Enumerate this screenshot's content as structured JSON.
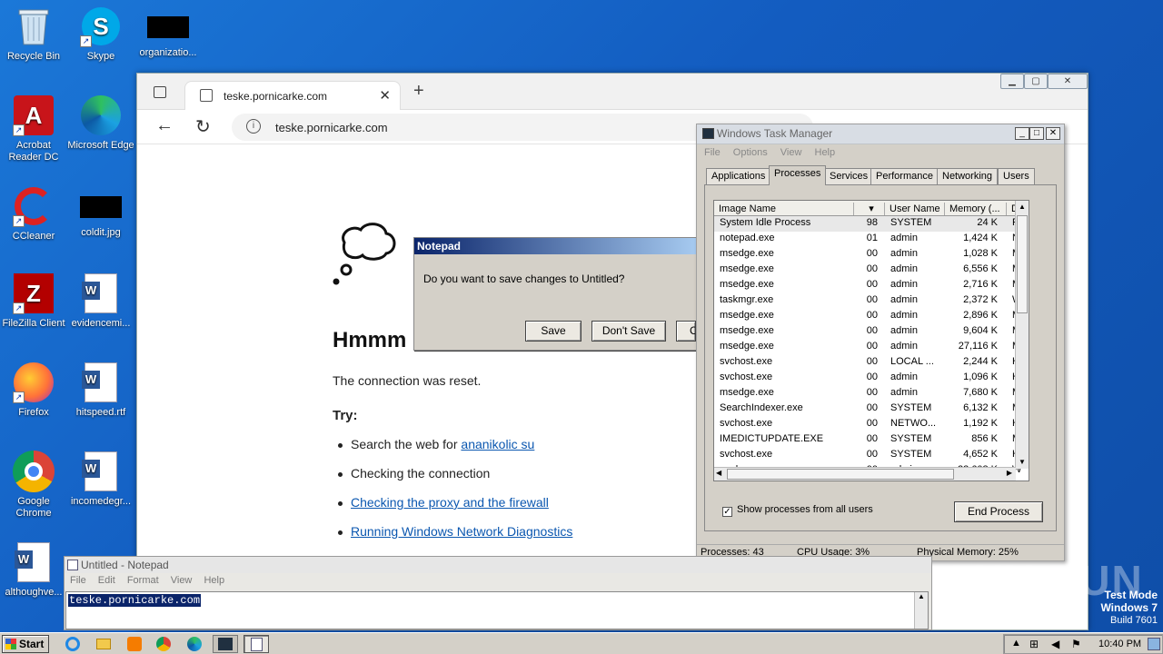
{
  "desktop": {
    "icons": [
      {
        "label": "Recycle Bin"
      },
      {
        "label": "Skype"
      },
      {
        "label": "organizatio..."
      },
      {
        "label": "Acrobat Reader DC"
      },
      {
        "label": "Microsoft Edge"
      },
      {
        "label": "CCleaner"
      },
      {
        "label": "coldit.jpg"
      },
      {
        "label": "FileZilla Client"
      },
      {
        "label": "evidencemi..."
      },
      {
        "label": "Firefox"
      },
      {
        "label": "hitspeed.rtf"
      },
      {
        "label": "Google Chrome"
      },
      {
        "label": "incomedegr..."
      },
      {
        "label": "althoughve..."
      }
    ]
  },
  "browser": {
    "tab_title": "teske.pornicarke.com",
    "url": "teske.pornicarke.com",
    "error": {
      "title": "Hmmm",
      "line": "The connection was reset.",
      "try_heading": "Try:",
      "suggestion_prefix": "Search the web for ",
      "suggestion_link": "ananikolic su",
      "item2": "Checking the connection",
      "item3": "Checking the proxy and the firewall",
      "item4": "Running Windows Network Diagnostics"
    }
  },
  "save_dialog": {
    "title": "Notepad",
    "message": "Do you want to save changes to Untitled?",
    "save": "Save",
    "dont_save": "Don't Save",
    "cancel": "C"
  },
  "task_manager": {
    "title": "Windows Task Manager",
    "menu": [
      "File",
      "Options",
      "View",
      "Help"
    ],
    "tabs": [
      "Applications",
      "Processes",
      "Services",
      "Performance",
      "Networking",
      "Users"
    ],
    "active_tab": "Processes",
    "columns": [
      "Image Name",
      "User Name",
      "Memory (...",
      "D"
    ],
    "rows": [
      {
        "name": "System Idle Process",
        "cpu": "98",
        "user": "SYSTEM",
        "mem": "24 K",
        "d": "Pe"
      },
      {
        "name": "notepad.exe",
        "cpu": "01",
        "user": "admin",
        "mem": "1,424 K",
        "d": "N"
      },
      {
        "name": "msedge.exe",
        "cpu": "00",
        "user": "admin",
        "mem": "1,028 K",
        "d": "M"
      },
      {
        "name": "msedge.exe",
        "cpu": "00",
        "user": "admin",
        "mem": "6,556 K",
        "d": "M"
      },
      {
        "name": "msedge.exe",
        "cpu": "00",
        "user": "admin",
        "mem": "2,716 K",
        "d": "M"
      },
      {
        "name": "taskmgr.exe",
        "cpu": "00",
        "user": "admin",
        "mem": "2,372 K",
        "d": "W"
      },
      {
        "name": "msedge.exe",
        "cpu": "00",
        "user": "admin",
        "mem": "2,896 K",
        "d": "M"
      },
      {
        "name": "msedge.exe",
        "cpu": "00",
        "user": "admin",
        "mem": "9,604 K",
        "d": "M"
      },
      {
        "name": "msedge.exe",
        "cpu": "00",
        "user": "admin",
        "mem": "27,116 K",
        "d": "M"
      },
      {
        "name": "svchost.exe",
        "cpu": "00",
        "user": "LOCAL ...",
        "mem": "2,244 K",
        "d": "H"
      },
      {
        "name": "svchost.exe",
        "cpu": "00",
        "user": "admin",
        "mem": "1,096 K",
        "d": "H"
      },
      {
        "name": "msedge.exe",
        "cpu": "00",
        "user": "admin",
        "mem": "7,680 K",
        "d": "M"
      },
      {
        "name": "SearchIndexer.exe",
        "cpu": "00",
        "user": "SYSTEM",
        "mem": "6,132 K",
        "d": "M"
      },
      {
        "name": "svchost.exe",
        "cpu": "00",
        "user": "NETWO...",
        "mem": "1,192 K",
        "d": "H"
      },
      {
        "name": "IMEDICTUPDATE.EXE",
        "cpu": "00",
        "user": "SYSTEM",
        "mem": "856 K",
        "d": "M"
      },
      {
        "name": "svchost.exe",
        "cpu": "00",
        "user": "SYSTEM",
        "mem": "4,652 K",
        "d": "H"
      },
      {
        "name": "explorer.exe",
        "cpu": "00",
        "user": "admin",
        "mem": "23,608 K",
        "d": "W"
      }
    ],
    "show_all_label": "Show processes from all users",
    "end_process": "End Process",
    "status": {
      "processes": "Processes: 43",
      "cpu": "CPU Usage: 3%",
      "memory": "Physical Memory: 25%"
    }
  },
  "notepad": {
    "title": "Untitled - Notepad",
    "menu": [
      "File",
      "Edit",
      "Format",
      "View",
      "Help"
    ],
    "content": "teske.pornicarke.com"
  },
  "taskbar": {
    "start": "Start",
    "clock": "10:40 PM"
  },
  "watermark": {
    "brand": "ANY RUN",
    "mode": "Test Mode",
    "os": "Windows 7",
    "build": "Build 7601"
  }
}
